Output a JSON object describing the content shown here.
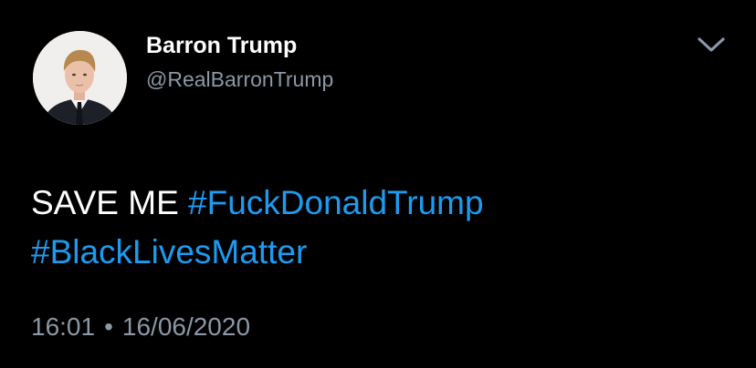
{
  "user": {
    "display_name": "Barron Trump",
    "handle": "@RealBarronTrump"
  },
  "tweet": {
    "text": "SAVE ME",
    "hashtags": [
      "#FuckDonaldTrump",
      "#BlackLivesMatter"
    ],
    "time": "16:01",
    "separator": "•",
    "date": "16/06/2020"
  },
  "icons": {
    "menu": "chevron-down-icon",
    "avatar": "avatar"
  },
  "colors": {
    "background": "#000000",
    "text": "#ffffff",
    "secondary": "#8b98a5",
    "link": "#1d9bf0"
  }
}
